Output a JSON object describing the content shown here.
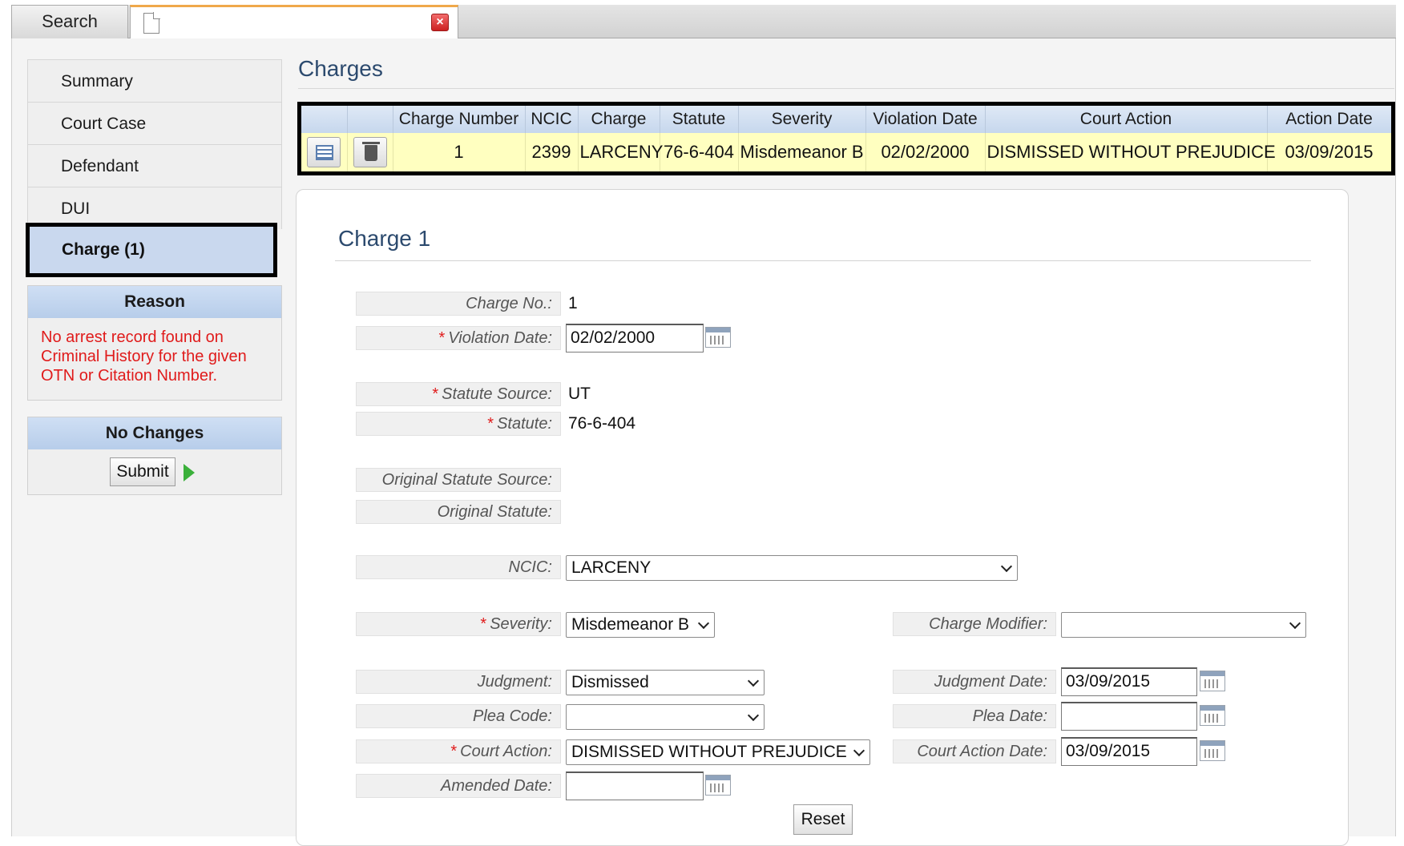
{
  "tabs": {
    "search_label": "Search"
  },
  "nav": {
    "items": [
      {
        "label": "Summary"
      },
      {
        "label": "Court Case"
      },
      {
        "label": "Defendant"
      },
      {
        "label": "DUI"
      }
    ],
    "active_label": "Charge (1)"
  },
  "reason": {
    "title": "Reason",
    "text": "No arrest record found on Criminal History for the given OTN or Citation Number."
  },
  "changes": {
    "title": "No Changes",
    "submit_label": "Submit"
  },
  "charges": {
    "title": "Charges",
    "columns": [
      "Charge Number",
      "NCIC",
      "Charge",
      "Statute",
      "Severity",
      "Violation Date",
      "Court Action",
      "Action Date"
    ],
    "rows": [
      {
        "charge_number": "1",
        "ncic": "2399",
        "charge": "LARCENY",
        "statute": "76-6-404",
        "severity": "Misdemeanor B",
        "violation_date": "02/02/2000",
        "court_action": "DISMISSED WITHOUT PREJUDICE",
        "action_date": "03/09/2015"
      }
    ]
  },
  "form": {
    "title": "Charge 1",
    "required_mark": "*",
    "labels": {
      "charge_no": "Charge No.:",
      "violation_date": "Violation Date:",
      "statute_source": "Statute Source:",
      "statute": "Statute:",
      "original_statute_source": "Original Statute Source:",
      "original_statute": "Original Statute:",
      "ncic": "NCIC:",
      "severity": "Severity:",
      "charge_modifier": "Charge Modifier:",
      "judgment": "Judgment:",
      "judgment_date": "Judgment Date:",
      "plea_code": "Plea Code:",
      "plea_date": "Plea Date:",
      "court_action": "Court Action:",
      "court_action_date": "Court Action Date:",
      "amended_date": "Amended Date:"
    },
    "values": {
      "charge_no": "1",
      "violation_date": "02/02/2000",
      "statute_source": "UT",
      "statute": "76-6-404",
      "ncic": "LARCENY",
      "severity": "Misdemeanor B",
      "charge_modifier": "",
      "judgment": "Dismissed",
      "judgment_date": "03/09/2015",
      "plea_code": "",
      "plea_date": "",
      "court_action": "DISMISSED WITHOUT PREJUDICE",
      "court_action_date": "03/09/2015",
      "amended_date": ""
    },
    "reset_label": "Reset"
  },
  "icons": {
    "doc": "document-icon",
    "close": "close-icon",
    "edit": "list-icon",
    "delete": "trash-icon",
    "calendar": "calendar-icon",
    "play": "play-icon"
  },
  "colors": {
    "required": "#e01b1b",
    "row_highlight": "#ffffc0",
    "header_blue": "#c6d7ed",
    "title_blue": "#2c4a6e"
  }
}
